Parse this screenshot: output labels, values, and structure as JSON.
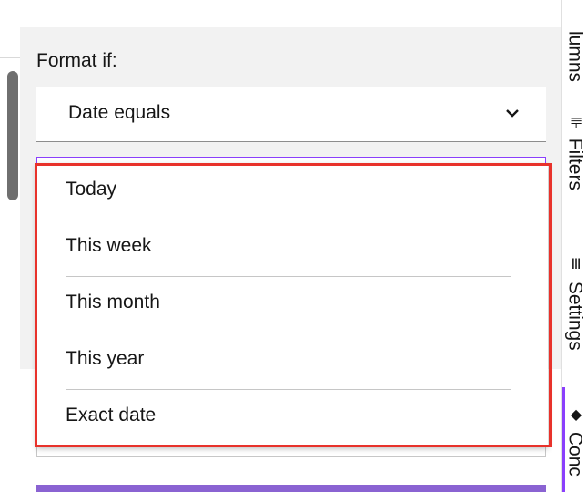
{
  "filter": {
    "label": "Format if:",
    "selected": "Date equals"
  },
  "menu": {
    "options": [
      {
        "label": "Today"
      },
      {
        "label": "This week"
      },
      {
        "label": "This month"
      },
      {
        "label": "This year"
      },
      {
        "label": "Exact date"
      }
    ]
  },
  "rail": {
    "columns_label": "lumns",
    "filters_label": "Filters",
    "settings_label": "Settings",
    "conditional_label": "Conc"
  },
  "colors": {
    "accent": "#8a3ffc",
    "highlight": "#e8322b",
    "primary_button": "#8a63d2"
  },
  "icons": {
    "dropdown": "chevron-down-icon",
    "filters": "filter-icon",
    "settings": "settings-icon",
    "conditional": "paint-bucket-icon"
  }
}
